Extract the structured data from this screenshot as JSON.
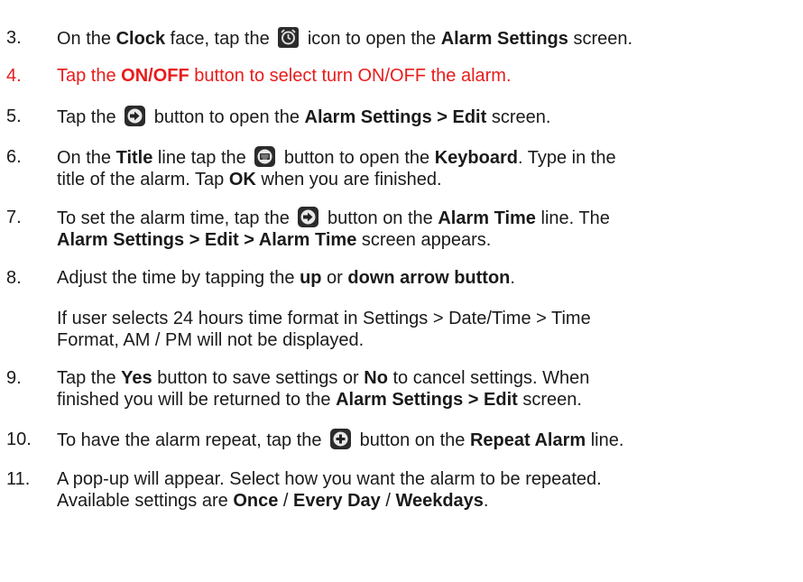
{
  "steps": [
    {
      "num": "3.",
      "parts": [
        "On the ",
        "Clock",
        " face, tap the ",
        " icon to open the ",
        "Alarm Settings",
        " screen."
      ]
    },
    {
      "num": "4.",
      "parts": [
        "Tap the ",
        "ON/OFF",
        " button to select turn ON/OFF the alarm."
      ]
    },
    {
      "num": "5.",
      "parts": [
        "Tap the ",
        " button to open the ",
        "Alarm Settings > Edit",
        " screen."
      ]
    },
    {
      "num": "6.",
      "parts": [
        "On the ",
        "Title",
        " line tap the ",
        " button to open the ",
        "Keyboard",
        ".  Type in the",
        "title of the alarm.  Tap ",
        "OK",
        " when you are finished."
      ]
    },
    {
      "num": "7.",
      "parts": [
        "To set the alarm time, tap the ",
        " button on the ",
        "Alarm Time",
        " line.  The",
        "Alarm Settings > Edit > Alarm Time",
        " screen appears."
      ]
    },
    {
      "num": "8.",
      "parts": [
        "Adjust the time by tapping the ",
        "up",
        " or ",
        "down arrow button",
        "."
      ]
    },
    {
      "num": "9.",
      "parts": [
        "Tap the ",
        "Yes",
        " button to save settings or ",
        "No",
        " to cancel settings.  When",
        "finished you will be returned to the ",
        "Alarm Settings > Edit",
        " screen."
      ]
    },
    {
      "num": "10.",
      "parts": [
        "To have the alarm repeat, tap the ",
        " button on the ",
        "Repeat Alarm",
        " line."
      ]
    },
    {
      "num": "11.",
      "parts": [
        "A pop-up will appear.  Select how you want the alarm to be repeated.",
        "Available settings are ",
        "Once",
        " / ",
        "Every Day",
        " / ",
        "Weekdays",
        "."
      ]
    }
  ],
  "note": [
    "If user selects 24 hours time format in Settings > Date/Time > Time",
    "Format, AM / PM will not be displayed."
  ],
  "colors": {
    "text": "#1a1a1a",
    "highlight": "#e81c1c",
    "icon_bg": "#2b2b2b"
  },
  "icons": [
    "alarm-clock-icon",
    "arrow-right-icon",
    "keyboard-icon",
    "arrow-right-icon",
    "plus-icon"
  ]
}
